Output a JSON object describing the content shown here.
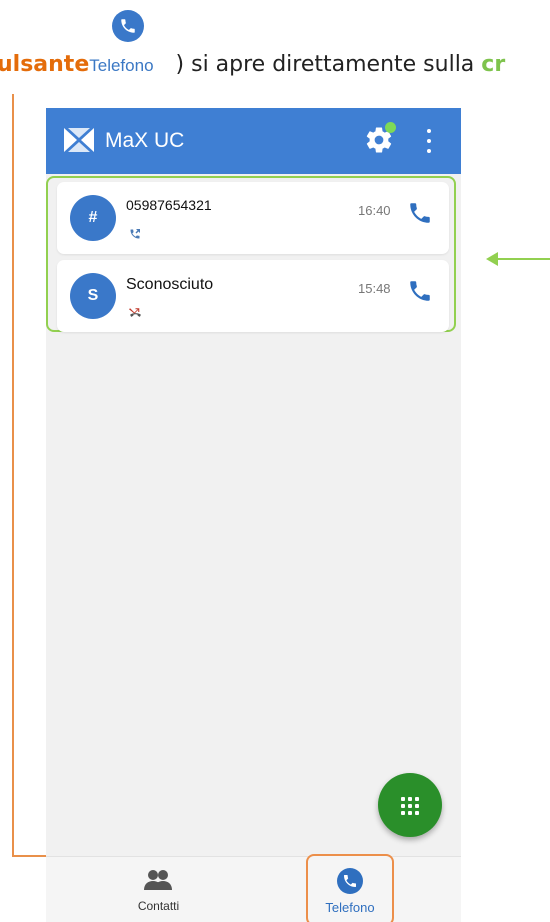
{
  "caption": {
    "prefix": "ulsante",
    "button_name": "Telefono",
    "middle": ") si apre direttamente sulla",
    "suffix": "cr",
    "icon": "phone-icon"
  },
  "app": {
    "title": "MaX UC",
    "logo": "max-logo-icon",
    "settings_icon": "gear-icon",
    "menu_icon": "more-vert-icon",
    "primary_color": "#3f7fd3"
  },
  "calls": [
    {
      "avatar": "#",
      "name": "05987654321",
      "time": "16:40",
      "status": "outgoing-call-icon"
    },
    {
      "avatar": "S",
      "name": "Sconosciuto",
      "time": "15:48",
      "status": "missed-call-icon"
    }
  ],
  "fab": {
    "icon": "dialpad-icon",
    "color": "#2a8f2a"
  },
  "bottom_nav": {
    "contacts_label": "Contatti",
    "phone_label": "Telefono"
  },
  "annotations": {
    "orange": "#e9904a",
    "green": "#92d050"
  }
}
